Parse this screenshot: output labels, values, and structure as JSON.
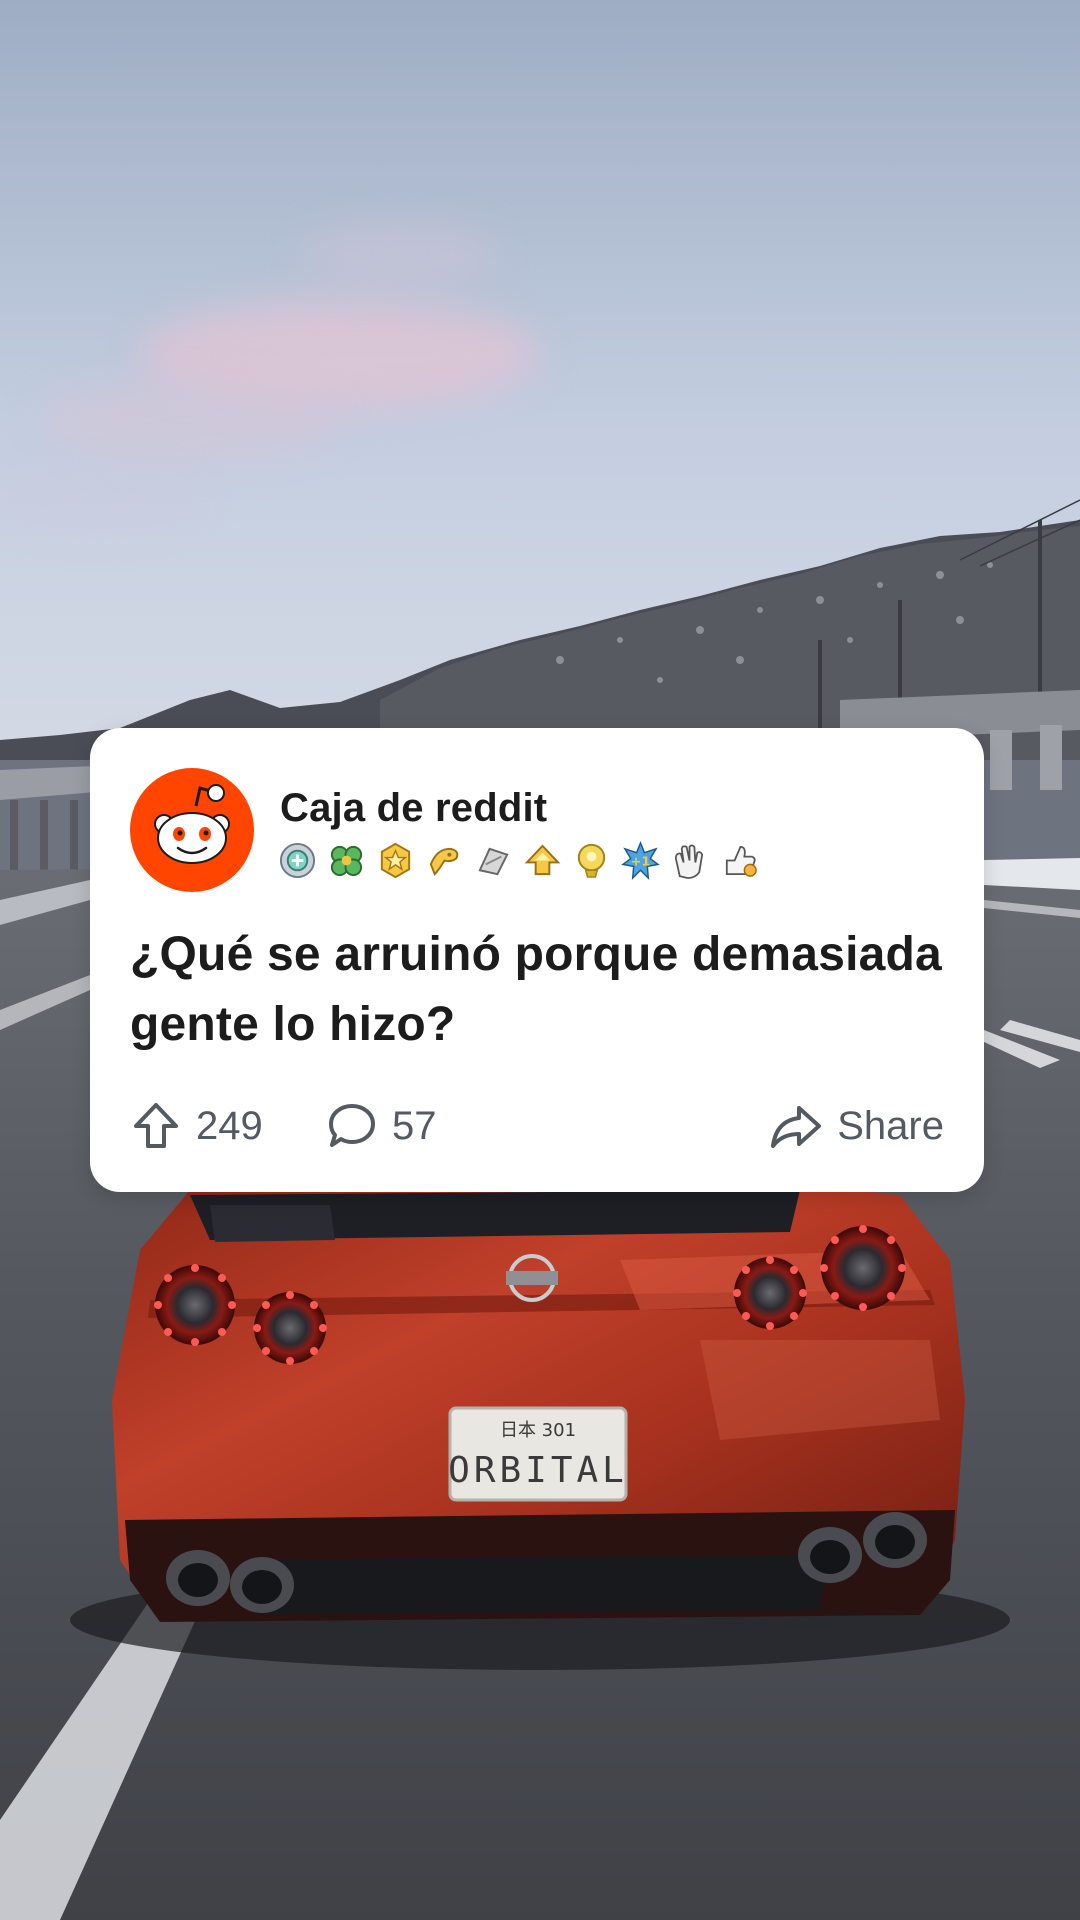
{
  "post": {
    "subreddit": "Caja de reddit",
    "title": "¿Qué se arruinó porque demasiada gente lo hizo?",
    "upvotes": "249",
    "comments": "57",
    "share_label": "Share"
  },
  "awards": [
    "silver-medal-icon",
    "clover-icon",
    "gold-star-icon",
    "wholesome-icon",
    "helpful-icon",
    "upvote-gold-icon",
    "trophy-icon",
    "plus-one-icon",
    "clapping-hands-icon",
    "thumbs-up-icon"
  ],
  "colors": {
    "reddit_orange": "#FF4500",
    "card_bg": "#FFFFFF",
    "text_primary": "#1C1C1C",
    "text_secondary": "#545A62",
    "car_red": "#B8331E"
  },
  "scene": {
    "license_plate_top": "日本 301",
    "license_plate_main": "ORBITAL",
    "car_badge": "NISSAN"
  }
}
